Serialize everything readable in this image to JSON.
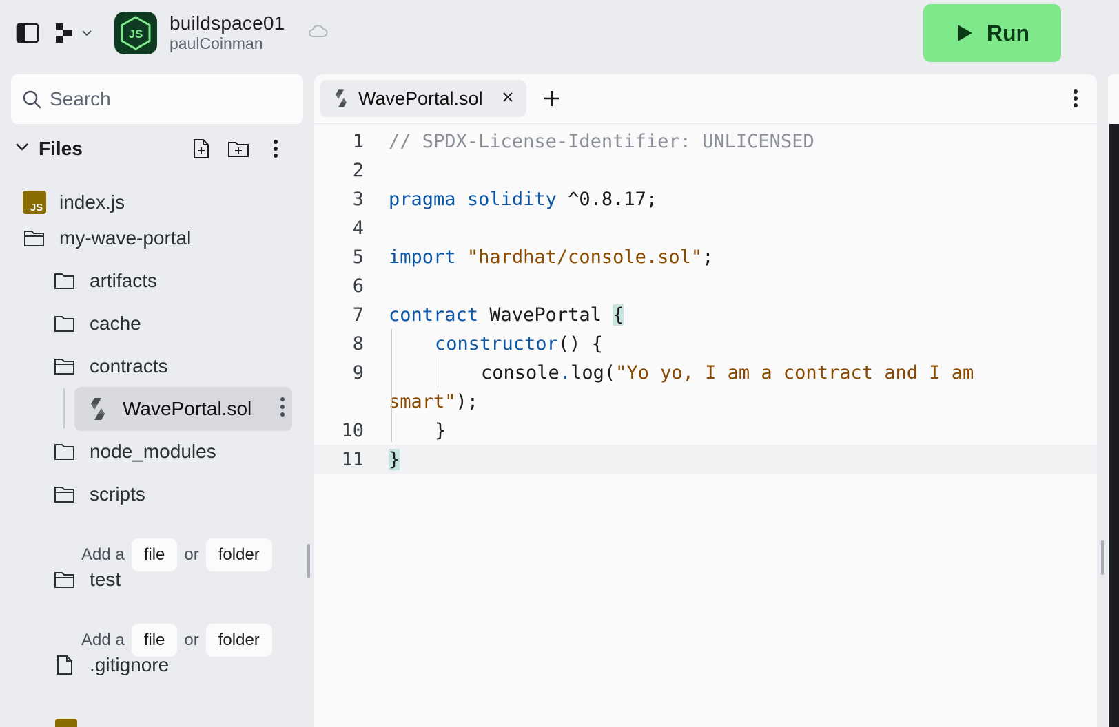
{
  "header": {
    "repl_name": "buildspace01",
    "repl_owner": "paulCoinman",
    "repl_language_badge": "JS",
    "run_label": "Run",
    "icons": [
      "sidebar-toggle-icon",
      "layout-icon",
      "chevron-down-icon",
      "cloud-icon",
      "play-icon"
    ]
  },
  "sidebar": {
    "search_placeholder": "Search",
    "files_title": "Files",
    "tree": [
      {
        "name": "index.js",
        "type": "js-file",
        "depth": 0
      },
      {
        "name": "my-wave-portal",
        "type": "folder-open",
        "depth": 0
      },
      {
        "name": "artifacts",
        "type": "folder",
        "depth": 1
      },
      {
        "name": "cache",
        "type": "folder",
        "depth": 1
      },
      {
        "name": "contracts",
        "type": "folder-open",
        "depth": 1
      },
      {
        "name": "WavePortal.sol",
        "type": "solidity-file",
        "depth": 2,
        "selected": true
      },
      {
        "name": "node_modules",
        "type": "folder",
        "depth": 1
      },
      {
        "name": "scripts",
        "type": "folder-open",
        "depth": 1
      },
      {
        "name": "test",
        "type": "folder-open",
        "depth": 1
      },
      {
        "name": ".gitignore",
        "type": "file",
        "depth": 1
      }
    ],
    "add_prompt": {
      "prefix": "Add a",
      "file": "file",
      "or": "or",
      "folder": "folder"
    }
  },
  "editor": {
    "tab_label": "WavePortal.sol",
    "lines": [
      {
        "n": "1",
        "text": "// SPDX-License-Identifier: UNLICENSED"
      },
      {
        "n": "2",
        "text": ""
      },
      {
        "n": "3",
        "text": "pragma solidity ^0.8.17;"
      },
      {
        "n": "4",
        "text": ""
      },
      {
        "n": "5",
        "text": "import \"hardhat/console.sol\";"
      },
      {
        "n": "6",
        "text": ""
      },
      {
        "n": "7",
        "text": "contract WavePortal {"
      },
      {
        "n": "8",
        "text": "constructor() {"
      },
      {
        "n": "9",
        "text": "console.log(\"Yo yo, I am a contract and I am"
      },
      {
        "n": "",
        "text": "smart\");"
      },
      {
        "n": "10",
        "text": "}"
      },
      {
        "n": "11",
        "text": "}"
      }
    ],
    "active_line": "11"
  },
  "colors": {
    "run_button": "#7fe88a",
    "keyword": "#0b57a6",
    "string": "#8a4a00",
    "comment": "#8a8f98",
    "js_badge": "#8a6d00"
  }
}
